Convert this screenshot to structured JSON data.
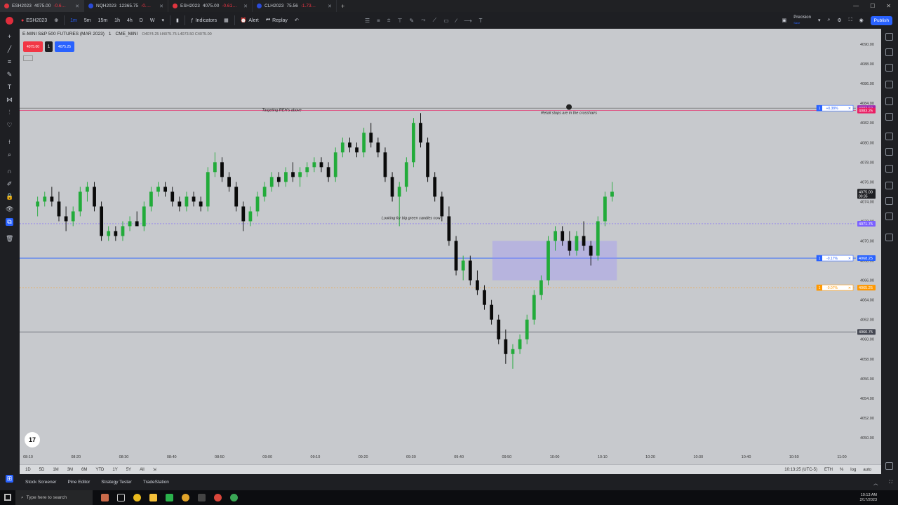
{
  "browser_tabs": [
    {
      "symbol": "ESH2023",
      "price": "4075.00",
      "change": "-0.6…"
    },
    {
      "symbol": "NQH2023",
      "price": "12365.75",
      "change": "-0.…"
    },
    {
      "symbol": "ESH2023",
      "price": "4075.00",
      "change": "-0.61…"
    },
    {
      "symbol": "CLH2023",
      "price": "75.56",
      "change": "-1.73…"
    }
  ],
  "toolbar": {
    "symbol": "ESH2023",
    "intervals": [
      "1m",
      "5m",
      "15m",
      "1h",
      "4h",
      "D",
      "W"
    ],
    "active_interval": "1m",
    "indicators_label": "Indicators",
    "alert_label": "Alert",
    "replay_label": "Replay",
    "precision_label": "Precision",
    "precision_sub": "Save",
    "publish_label": "Publish"
  },
  "legend": {
    "title": "E-MINI S&P 500 FUTURES (MAR 2023)",
    "interval": "1",
    "exchange": "CME_MINI",
    "ohlc": "O4074.25 H4075.75 L4073.50 C4075.00"
  },
  "trade": {
    "sell": "4075.00",
    "qty": "1",
    "buy": "4075.25"
  },
  "notes": [
    {
      "text": "Targeting REH's above",
      "price": 4083.2,
      "time": 9.05
    },
    {
      "text": "Retail stops are in the crosshairs",
      "price": 4082.9,
      "time": 10.05
    },
    {
      "text": "Looking for big green candles now",
      "price": 4072.2,
      "time": 9.5
    }
  ],
  "price_axis": {
    "min": 4049,
    "max": 4091,
    "ticks": [
      "4090.00",
      "4088.00",
      "4086.00",
      "4084.00",
      "4082.00",
      "4080.00",
      "4078.00",
      "4076.00",
      "4074.00",
      "4072.00",
      "4070.00",
      "4068.00",
      "4066.00",
      "4064.00",
      "4062.00",
      "4060.00",
      "4058.00",
      "4056.00",
      "4054.00",
      "4052.00",
      "4050.00"
    ]
  },
  "time_axis": {
    "labels": [
      "08:10",
      "08:20",
      "08:30",
      "08:40",
      "08:50",
      "09:00",
      "09:10",
      "09:20",
      "09:30",
      "09:40",
      "09:50",
      "10:00",
      "10:10",
      "10:20",
      "10:30",
      "10:40",
      "10:50",
      "11:00"
    ]
  },
  "price_labels": [
    {
      "text": "4083.50",
      "price": 4083.5,
      "color": "#9c27b0"
    },
    {
      "text": "4083.25",
      "price": 4083.25,
      "color": "#e91e63"
    },
    {
      "text": "4075.00",
      "sub": "00:35",
      "price": 4075.0,
      "color": "#1e1f23"
    },
    {
      "text": "4071.75",
      "price": 4071.75,
      "color": "#7b61ff"
    },
    {
      "text": "4068.25",
      "price": 4068.25,
      "color": "#2962ff"
    },
    {
      "text": "4065.25",
      "price": 4065.25,
      "color": "#ff9800"
    },
    {
      "text": "4060.75",
      "price": 4060.75,
      "color": "#434651"
    }
  ],
  "order_tags": [
    {
      "qty": "1",
      "pct": "+0.38%",
      "price": 4083.5,
      "color": "#2962ff"
    },
    {
      "qty": "1",
      "pct": "-0.17%",
      "price": 4068.25,
      "color": "#2962ff"
    },
    {
      "qty": "1",
      "pct": "-0.07%",
      "price": 4065.25,
      "color": "#ff9800"
    }
  ],
  "date_ranges": [
    "1D",
    "5D",
    "1M",
    "3M",
    "6M",
    "YTD",
    "1Y",
    "5Y",
    "All"
  ],
  "timebar_right": {
    "clock": "10:13:25 (UTC-5)",
    "session": "ETH",
    "pct": "%",
    "log": "log",
    "auto": "auto"
  },
  "panel_tabs": [
    "Stock Screener",
    "Pine Editor",
    "Strategy Tester",
    "TradeStation"
  ],
  "taskbar": {
    "search_placeholder": "Type here to search",
    "time": "10:13 AM",
    "date": "2/17/2023"
  },
  "chart_data": {
    "type": "candlestick",
    "title": "E-MINI S&P 500 FUTURES (MAR 2023)",
    "x_range": [
      "08:10",
      "11:00"
    ],
    "ylim": [
      4049,
      4091
    ],
    "levels": [
      4083.5,
      4083.25,
      4071.75,
      4068.25,
      4065.25,
      4060.75
    ],
    "zone": {
      "from_time": "09:47",
      "to_time": "10:13",
      "price_low": 4066.0,
      "price_high": 4070.0
    },
    "series": [
      {
        "name": "ESH2023",
        "candles": [
          [
            4073.5,
            4074.5,
            4072.5,
            4074.0
          ],
          [
            4074.0,
            4075.0,
            4073.5,
            4074.5
          ],
          [
            4074.5,
            4075.5,
            4073.5,
            4074.0
          ],
          [
            4074.0,
            4075.0,
            4072.0,
            4072.5
          ],
          [
            4072.5,
            4073.5,
            4071.0,
            4072.0
          ],
          [
            4072.0,
            4073.5,
            4071.5,
            4073.0
          ],
          [
            4073.0,
            4075.5,
            4072.5,
            4075.0
          ],
          [
            4075.0,
            4076.0,
            4074.0,
            4075.5
          ],
          [
            4075.5,
            4076.0,
            4073.0,
            4073.5
          ],
          [
            4073.5,
            4074.0,
            4070.0,
            4070.5
          ],
          [
            4070.5,
            4071.5,
            4070.0,
            4071.0
          ],
          [
            4071.0,
            4071.5,
            4070.0,
            4070.5
          ],
          [
            4070.5,
            4072.0,
            4070.0,
            4071.5
          ],
          [
            4071.5,
            4072.5,
            4071.0,
            4072.0
          ],
          [
            4072.0,
            4073.0,
            4071.5,
            4071.5
          ],
          [
            4071.5,
            4074.0,
            4071.0,
            4073.5
          ],
          [
            4073.5,
            4075.5,
            4073.0,
            4075.0
          ],
          [
            4075.0,
            4076.0,
            4074.5,
            4075.5
          ],
          [
            4075.5,
            4076.0,
            4074.5,
            4075.0
          ],
          [
            4075.0,
            4075.5,
            4073.5,
            4074.0
          ],
          [
            4074.0,
            4074.5,
            4073.0,
            4073.5
          ],
          [
            4073.5,
            4075.0,
            4073.0,
            4074.5
          ],
          [
            4074.5,
            4075.0,
            4073.5,
            4074.0
          ],
          [
            4074.0,
            4074.5,
            4073.0,
            4073.5
          ],
          [
            4073.5,
            4077.5,
            4073.0,
            4077.0
          ],
          [
            4077.0,
            4079.0,
            4076.5,
            4078.0
          ],
          [
            4078.0,
            4078.5,
            4076.0,
            4076.5
          ],
          [
            4076.5,
            4077.0,
            4075.0,
            4075.5
          ],
          [
            4075.5,
            4076.0,
            4073.0,
            4073.5
          ],
          [
            4073.5,
            4074.0,
            4071.0,
            4072.0
          ],
          [
            4072.0,
            4073.5,
            4071.5,
            4073.0
          ],
          [
            4073.0,
            4075.0,
            4072.5,
            4074.5
          ],
          [
            4074.5,
            4076.0,
            4074.0,
            4075.5
          ],
          [
            4075.5,
            4077.0,
            4075.0,
            4076.5
          ],
          [
            4076.5,
            4077.0,
            4075.5,
            4076.0
          ],
          [
            4076.0,
            4077.5,
            4075.5,
            4077.0
          ],
          [
            4077.0,
            4078.0,
            4076.0,
            4076.5
          ],
          [
            4076.5,
            4077.5,
            4075.5,
            4077.0
          ],
          [
            4077.0,
            4078.0,
            4076.5,
            4077.5
          ],
          [
            4077.5,
            4078.5,
            4077.0,
            4078.0
          ],
          [
            4078.0,
            4078.5,
            4077.0,
            4077.5
          ],
          [
            4077.5,
            4078.0,
            4076.0,
            4076.5
          ],
          [
            4076.5,
            4079.5,
            4076.0,
            4079.0
          ],
          [
            4079.0,
            4080.5,
            4078.5,
            4080.0
          ],
          [
            4080.0,
            4080.5,
            4079.0,
            4079.5
          ],
          [
            4079.5,
            4080.0,
            4078.5,
            4079.0
          ],
          [
            4079.0,
            4081.5,
            4078.5,
            4081.0
          ],
          [
            4081.0,
            4082.0,
            4079.5,
            4080.0
          ],
          [
            4080.0,
            4080.5,
            4078.5,
            4079.0
          ],
          [
            4079.0,
            4079.5,
            4076.0,
            4076.5
          ],
          [
            4076.5,
            4077.0,
            4074.0,
            4074.5
          ],
          [
            4074.5,
            4076.0,
            4071.5,
            4075.5
          ],
          [
            4075.5,
            4078.5,
            4075.0,
            4078.0
          ],
          [
            4078.0,
            4082.5,
            4077.5,
            4082.0
          ],
          [
            4082.0,
            4083.0,
            4079.5,
            4080.0
          ],
          [
            4080.0,
            4080.5,
            4076.0,
            4076.5
          ],
          [
            4076.5,
            4077.0,
            4074.0,
            4074.5
          ],
          [
            4074.5,
            4075.0,
            4072.0,
            4072.5
          ],
          [
            4072.5,
            4073.5,
            4069.5,
            4070.0
          ],
          [
            4070.0,
            4070.5,
            4066.5,
            4067.0
          ],
          [
            4067.0,
            4068.5,
            4066.0,
            4068.0
          ],
          [
            4068.0,
            4068.5,
            4065.5,
            4066.0
          ],
          [
            4066.0,
            4067.0,
            4064.5,
            4065.0
          ],
          [
            4065.0,
            4065.5,
            4063.0,
            4063.5
          ],
          [
            4063.5,
            4064.0,
            4061.5,
            4062.0
          ],
          [
            4062.0,
            4062.5,
            4059.5,
            4060.0
          ],
          [
            4060.0,
            4061.0,
            4057.5,
            4058.5
          ],
          [
            4058.5,
            4059.5,
            4057.0,
            4059.0
          ],
          [
            4059.0,
            4060.5,
            4058.5,
            4060.0
          ],
          [
            4060.0,
            4062.5,
            4059.5,
            4062.0
          ],
          [
            4062.0,
            4065.0,
            4061.5,
            4064.5
          ],
          [
            4064.5,
            4066.5,
            4064.0,
            4066.0
          ],
          [
            4066.0,
            4070.5,
            4065.5,
            4070.0
          ],
          [
            4070.0,
            4071.5,
            4069.0,
            4071.0
          ],
          [
            4071.0,
            4071.5,
            4069.5,
            4070.0
          ],
          [
            4070.0,
            4071.0,
            4068.5,
            4069.0
          ],
          [
            4069.0,
            4071.0,
            4068.5,
            4070.5
          ],
          [
            4070.5,
            4072.0,
            4069.0,
            4069.5
          ],
          [
            4069.5,
            4070.0,
            4067.5,
            4068.5
          ],
          [
            4068.5,
            4072.5,
            4068.0,
            4072.0
          ],
          [
            4072.0,
            4075.0,
            4071.5,
            4074.5
          ],
          [
            4074.5,
            4076.0,
            4074.0,
            4075.0
          ]
        ]
      }
    ]
  }
}
